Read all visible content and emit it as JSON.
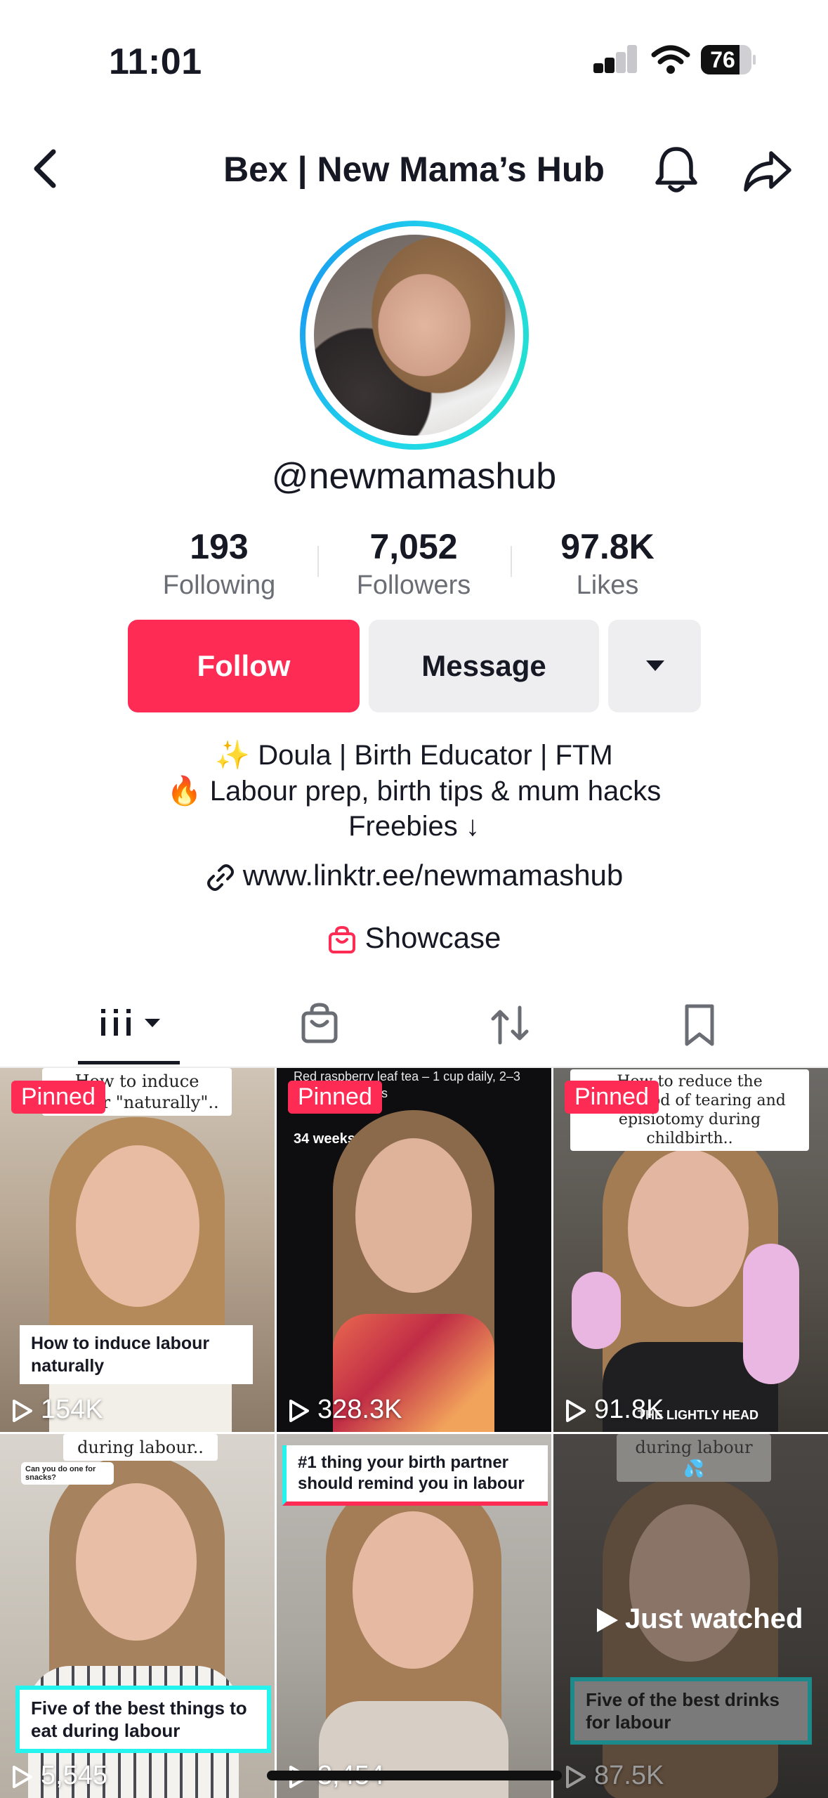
{
  "status_bar": {
    "time": "11:01",
    "battery": "76",
    "battery_level": 0.76
  },
  "header": {
    "title": "Bex | New Mama’s Hub"
  },
  "profile": {
    "handle": "@newmamashub",
    "stats": [
      {
        "value": "193",
        "label": "Following"
      },
      {
        "value": "7,052",
        "label": "Followers"
      },
      {
        "value": "97.8K",
        "label": "Likes"
      }
    ],
    "follow_label": "Follow",
    "message_label": "Message",
    "bio": [
      "✨ Doula | Birth Educator | FTM",
      "🔥 Labour prep, birth tips & mum hacks",
      "Freebies ↓"
    ],
    "link": "www.linktr.ee/newmamashub",
    "showcase": "Showcase"
  },
  "colors": {
    "accent": "#fe2c55",
    "ring": "#20d5ec",
    "button_gray": "#eeeef0"
  },
  "tabs": [
    {
      "icon": "grid-icon",
      "active": true
    },
    {
      "icon": "shop-bag-icon",
      "active": false
    },
    {
      "icon": "repost-icon",
      "active": false
    },
    {
      "icon": "bookmark-icon",
      "active": false
    }
  ],
  "videos": [
    {
      "pinned": "Pinned",
      "views": "154K",
      "top_caption": "How to induce labour \"naturally\"..",
      "overlay": "How to induce labour naturally"
    },
    {
      "pinned": "Pinned",
      "views": "328.3K",
      "top_caption": "Red raspberry leaf tea – 1 cup daily, 2–3 cups over weeks",
      "overlay": "34 weeks"
    },
    {
      "pinned": "Pinned",
      "views": "91.8K",
      "top_caption": "How to reduce the likelihood of tearing and episiotomy during childbirth..",
      "overlay": "THE LIGHTLY HEAD"
    },
    {
      "views": "5,545",
      "top_caption": "during labour..",
      "reply": "Can you do one for snacks?",
      "overlay": "Five of the best things to eat during labour"
    },
    {
      "views": "3,454",
      "overlay": "#1 thing your birth partner should remind you in labour"
    },
    {
      "views": "87.5K",
      "top_caption": "during labour 💦",
      "overlay": "Five of the best drinks for labour",
      "status": "Just watched"
    }
  ]
}
